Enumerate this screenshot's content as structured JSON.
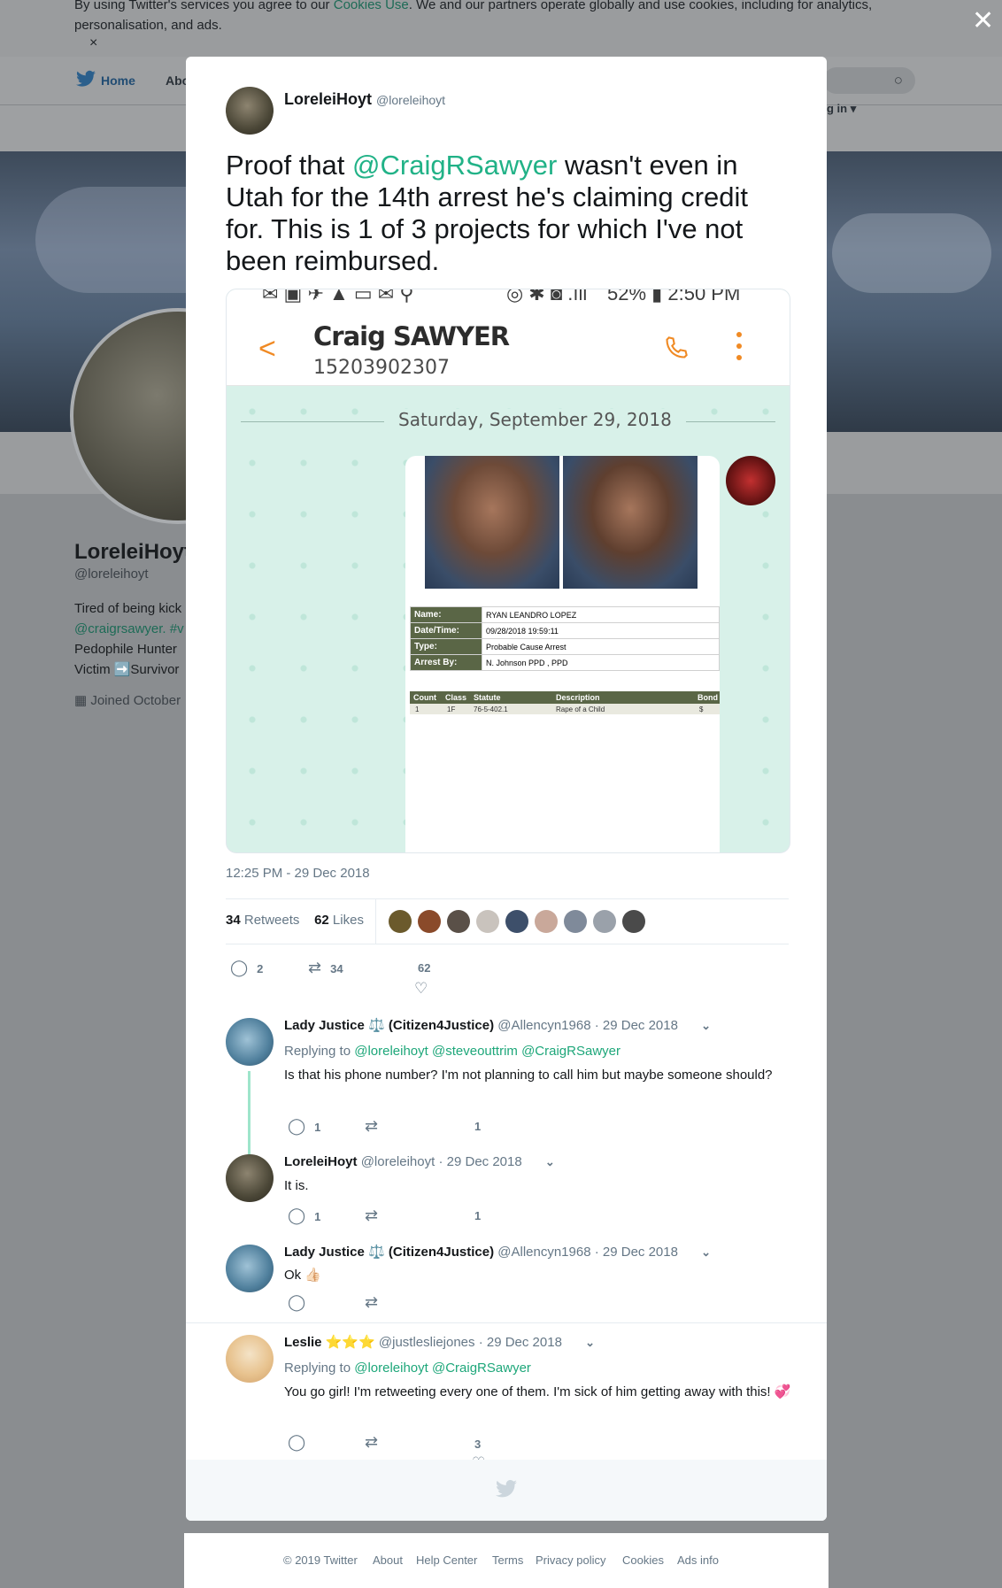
{
  "cookie_bar": {
    "text_before": "By using Twitter's services you agree to our ",
    "link": "Cookies Use",
    "text_after": ". We and our partners operate globally and use cookies, including for analytics, personalisation, and ads.",
    "dismiss": "×"
  },
  "close_button": "✕",
  "nav": {
    "home": "Home",
    "about_partial": "Abo",
    "login_partial": "g in ▾"
  },
  "profile": {
    "name_partial": "LoreleiHoyt",
    "handle": "@loreleihoyt",
    "bio_line1": "Tired of being kick",
    "bio_line2_link": "@craigrsawyer. #v",
    "bio_line3": "Pedophile Hunter",
    "bio_line4": "Victim ➡️Survivor",
    "joined": "Joined October"
  },
  "tweet": {
    "author_name": "LoreleiHoyt",
    "author_handle": "@loreleihoyt",
    "text_1": "Proof that ",
    "mention": "@CraigRSawyer",
    "text_2": " wasn't even in Utah for the 14th arrest he's claiming credit for. This is 1 of 3 projects for which I've not been reimbursed.",
    "timestamp": "12:25 PM - 29 Dec 2018",
    "retweets_count": "34",
    "retweets_label": "Retweets",
    "likes_count": "62",
    "likes_label": "Likes",
    "actions": {
      "replies": "2",
      "retweets": "34",
      "likes": "62"
    }
  },
  "screenshot_image": {
    "status_time": "52% ▮ 2:50 PM",
    "contact_name": "Craig SAWYER",
    "contact_number": "15203902307",
    "date_divider": "Saturday, September 29, 2018",
    "record": {
      "name_label": "Name:",
      "name_value": "RYAN LEANDRO LOPEZ",
      "date_label": "Date/Time:",
      "date_value": "09/28/2018 19:59:11",
      "type_label": "Type:",
      "type_value": "Probable Cause Arrest",
      "arrest_label": "Arrest By:",
      "arrest_value": "N. Johnson PPD , PPD",
      "head_count": "Count",
      "head_class": "Class",
      "head_statute": "Statute",
      "head_desc": "Description",
      "head_bond": "Bond",
      "row_count": "1",
      "row_class": "1F",
      "row_statute": "76-5-402.1",
      "row_desc": "Rape of a Child",
      "row_bond": "$"
    }
  },
  "likers_colors": [
    "#6b5a2c",
    "#8a4a2a",
    "#5a5048",
    "#c9c3bd",
    "#3d4f6a",
    "#c9a89a",
    "#7f8a9a",
    "#9aa1aa",
    "#4a4a4a"
  ],
  "replies": [
    {
      "name": "Lady Justice ⚖️ (Citizen4Justice)",
      "handle": "@Allencyn1968",
      "date": "· 29 Dec 2018",
      "replying_label": "Replying to ",
      "replying_to": "@loreleihoyt @steveouttrim @CraigRSawyer",
      "text": "Is that his phone number? I'm not planning to call him but maybe someone should?",
      "replies": "1",
      "likes": "1"
    },
    {
      "name": "LoreleiHoyt",
      "handle": "@loreleihoyt",
      "date": "· 29 Dec 2018",
      "text": "It is.",
      "replies": "1",
      "likes": "1"
    },
    {
      "name": "Lady Justice ⚖️ (Citizen4Justice)",
      "handle": "@Allencyn1968",
      "date": "· 29 Dec 2018",
      "text": "Ok 👍🏻"
    },
    {
      "name": "Leslie ⭐⭐⭐",
      "handle": "@justlesliejones",
      "date": "· 29 Dec 2018",
      "replying_label": "Replying to ",
      "replying_to": "@loreleihoyt @CraigRSawyer",
      "text": "You go girl! I'm retweeting every one of them. I'm sick of him getting away with this! 💞",
      "likes": "3"
    }
  ],
  "footer": {
    "copyright": "© 2019 Twitter",
    "about": "About",
    "help": "Help Center",
    "terms": "Terms",
    "privacy": "Privacy policy",
    "cookies": "Cookies",
    "ads": "Ads info"
  }
}
